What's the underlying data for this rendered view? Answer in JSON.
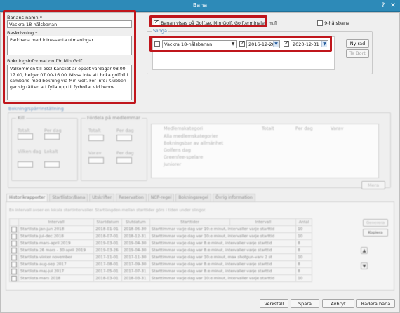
{
  "window": {
    "title": "Bana",
    "help": "?",
    "close": "✕"
  },
  "left": {
    "name_label": "Banans namn *",
    "name_value": "Vackra 18-hålsbanan",
    "desc_label": "Beskrivning *",
    "desc_value": "Parkbana med intressanta utmaningar.",
    "booking_label": "Bokningsinformation för Min Golf",
    "booking_value": "Välkommen till oss! Kansliet är öppet vardagar 08.00-17.00, helger 07.00-16.00. Missa inte att boka golfbil i samband med bokning via Min Golf. För info: Klubben ger sig rätten att fylla upp til fyrbollar vid behov."
  },
  "top_options": {
    "visible_label": "Banan visas på Golf.se, Min Golf, Golfterminalen m.fl",
    "visible_checked": true,
    "nine_hole_label": "9-hålsbana",
    "nine_hole_checked": false
  },
  "slinga": {
    "title": "Slinga",
    "course_value": "Vackra 18-hålsbanan",
    "course_checked": false,
    "date_from": "2016-12-26",
    "date_from_checked": true,
    "date_to": "2020-12-31",
    "date_to_checked": true,
    "new_row": "Ny rad",
    "remove": "Ta Bort"
  },
  "blurred": {
    "section_title": "Bokning/spärrinställning",
    "kill_title": "Kill",
    "kill_items": [
      "Totalt",
      "Per dag",
      "Vilken dag",
      "Lokalt"
    ],
    "options_title": "Fördela på medlemmar",
    "options_items": [
      "Totalt",
      "Per dag",
      "Varav",
      "Per dag"
    ],
    "list_items": [
      "Alla medlemskategorier",
      "Bokningsbar av allmänhet",
      "Golfens dag",
      "Greenfee-spelare",
      "Juniorer"
    ],
    "list_headers": [
      "Medlemskategori",
      "Totalt",
      "Per dag",
      "Varav"
    ],
    "more_btn": "Mera"
  },
  "tabs": [
    "Historikrapporter",
    "Startlistor/Bana",
    "Utskrifter",
    "Reservation",
    "NCP-regel",
    "Bokningsregel",
    "Övrig information"
  ],
  "history": {
    "note": "En intervall avser en lokala startintervaller. Startlängden mellan starttider görs i tiden under slingor.",
    "headers": [
      "",
      "Intervall",
      "Startdatum",
      "Slutdatum",
      "Starttider",
      "Intervall",
      "Antal"
    ],
    "rows": [
      [
        "Startlista jan-jun 2018",
        "2018-01-01",
        "2018-06-30",
        "Starttimmar varje dag var 10:e minut, intervaller varje starttid",
        "10"
      ],
      [
        "Startlista jul-dec 2018",
        "2018-07-01",
        "2018-12-31",
        "Starttimmar varje dag var 10:e minut, intervaller varje starttid",
        "10"
      ],
      [
        "Startlista mars-april 2019",
        "2019-03-01",
        "2019-04-30",
        "Starttimmar varje dag var 8:e minut, intervaller varje starttid",
        "8"
      ],
      [
        "Startlista 26 mars - 30 april 2019",
        "2019-03-26",
        "2019-04-30",
        "Starttimmar varje dag var 8:e minut, intervaller varje starttid",
        "8"
      ],
      [
        "Startlista vinter november",
        "2017-11-01",
        "2017-11-30",
        "Starttimmar varje dag var 10:e minut, max shotgun-varv 2 st",
        "10"
      ],
      [
        "Startlista aug-sep 2017",
        "2017-08-01",
        "2017-09-30",
        "Starttimmar varje dag var 8:e minut, intervaller varje starttid",
        "8"
      ],
      [
        "Startlista maj-jul 2017",
        "2017-05-01",
        "2017-07-31",
        "Starttimmar varje dag var 8:e minut, intervaller varje starttid",
        "8"
      ],
      [
        "Startlista mars 2018",
        "2018-03-01",
        "2018-03-31",
        "Starttimmar varje dag var 10:e minut, intervaller varje starttid",
        "10"
      ]
    ],
    "side_btn_1": "Generera",
    "side_btn_2": "Kopiera"
  },
  "footer": {
    "details": "Verkställ",
    "save": "Spara",
    "cancel": "Avbryt",
    "delete": "Radera bana"
  }
}
